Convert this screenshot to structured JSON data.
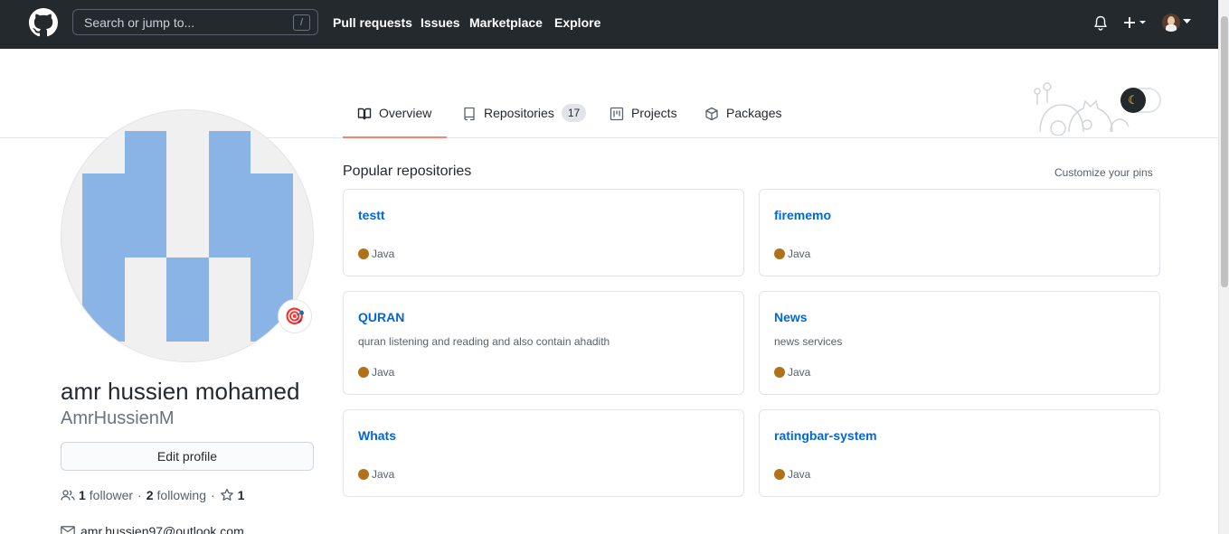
{
  "header": {
    "search_placeholder": "Search or jump to...",
    "search_shortcut": "/",
    "nav": [
      "Pull requests",
      "Issues",
      "Marketplace",
      "Explore"
    ],
    "bell_icon": "bell-icon",
    "plus_icon": "plus-icon",
    "avatar_icon": "user-avatar"
  },
  "tabs": [
    {
      "label": "Overview",
      "icon": "book-icon",
      "active": true
    },
    {
      "label": "Repositories",
      "icon": "repo-icon",
      "count": "17"
    },
    {
      "label": "Projects",
      "icon": "project-icon"
    },
    {
      "label": "Packages",
      "icon": "package-icon"
    }
  ],
  "profile": {
    "full_name": "amr hussien mohamed",
    "username": "AmrHussienM",
    "edit_label": "Edit profile",
    "followers_count": "1",
    "followers_label": "follower",
    "following_count": "2",
    "following_label": "following",
    "stars_count": "1",
    "email": "amr.hussien97@outlook.com",
    "status_emoji": "🎯"
  },
  "popular": {
    "title": "Popular repositories",
    "customize": "Customize your pins",
    "repos": [
      {
        "name": "testt",
        "description": "",
        "language": "Java"
      },
      {
        "name": "firememo",
        "description": "",
        "language": "Java"
      },
      {
        "name": "QURAN",
        "description": "quran listening and reading and also contain ahadith",
        "language": "Java"
      },
      {
        "name": "News",
        "description": "news services",
        "language": "Java"
      },
      {
        "name": "Whats",
        "description": "",
        "language": "Java"
      },
      {
        "name": "ratingbar-system",
        "description": "",
        "language": "Java"
      }
    ]
  },
  "colors": {
    "header_bg": "#24292e",
    "link": "#0366d6",
    "java": "#b07219",
    "tab_active_underline": "#f9826c"
  }
}
